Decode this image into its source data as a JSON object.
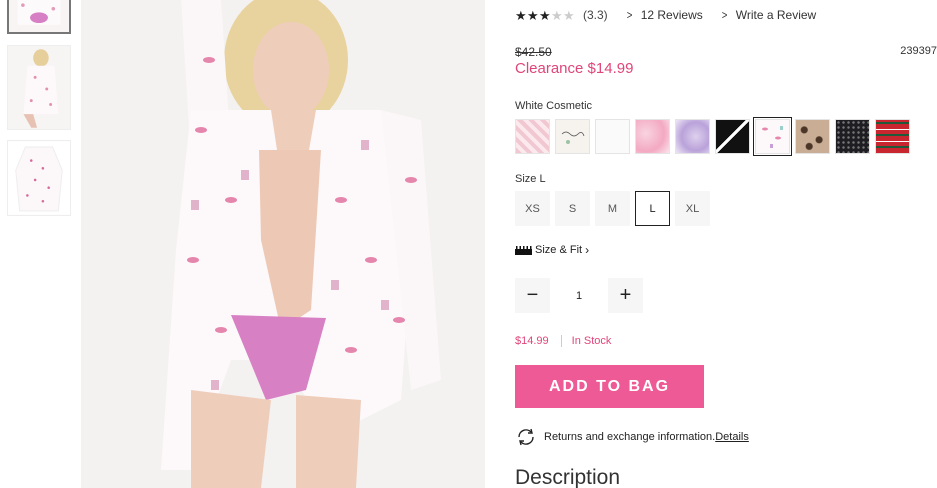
{
  "thumbnails": [
    {
      "alt": "front-cropped",
      "active": true
    },
    {
      "alt": "back-view",
      "active": false
    },
    {
      "alt": "flat-lay",
      "active": false
    }
  ],
  "rating": {
    "stars_value": 3.3,
    "stars_total": 5,
    "display": "(3.3)",
    "reviews_link": "12 Reviews",
    "write_review_link": "Write a Review"
  },
  "price": {
    "was": "$42.50",
    "clearance": "Clearance $14.99",
    "sku": "239397"
  },
  "color": {
    "selected_name": "White Cosmetic",
    "swatches": [
      {
        "name": "pink-plaid",
        "selected": false
      },
      {
        "name": "white-script",
        "selected": false
      },
      {
        "name": "white-solid",
        "selected": false
      },
      {
        "name": "pink-tie-dye",
        "selected": false
      },
      {
        "name": "lavender-tie-dye",
        "selected": false
      },
      {
        "name": "black-script",
        "selected": false
      },
      {
        "name": "white-cosmetic",
        "selected": true
      },
      {
        "name": "leopard",
        "selected": false
      },
      {
        "name": "black-dots",
        "selected": false
      },
      {
        "name": "red-plaid",
        "selected": false
      }
    ]
  },
  "size": {
    "label": "Size L",
    "options": [
      {
        "label": "XS",
        "selected": false
      },
      {
        "label": "S",
        "selected": false
      },
      {
        "label": "M",
        "selected": false
      },
      {
        "label": "L",
        "selected": true
      },
      {
        "label": "XL",
        "selected": false
      }
    ],
    "fit_link": "Size & Fit"
  },
  "quantity": {
    "minus": "−",
    "value": "1",
    "plus": "+"
  },
  "stock": {
    "price": "$14.99",
    "status": "In Stock"
  },
  "add_to_bag": "ADD TO BAG",
  "returns": {
    "text": "Returns and exchange information.",
    "link": "Details"
  },
  "description_heading": "Description",
  "icons": {
    "star": "star-icon",
    "chevron": "chevron-right-icon",
    "ruler": "ruler-icon",
    "returns": "returns-cycle-icon"
  },
  "colors": {
    "accent_pink": "#e0457b",
    "button_pink": "#ee5a96"
  }
}
